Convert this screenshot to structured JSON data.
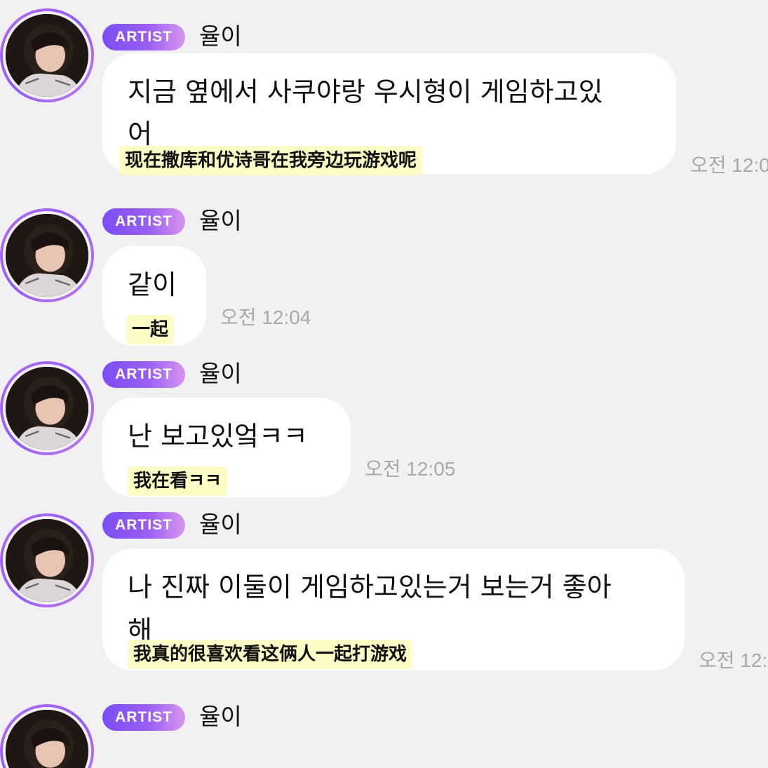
{
  "badge_label": "ARTIST",
  "author_name": "율이",
  "messages": [
    {
      "line1": "지금 옆에서 사쿠야랑 우시형이 게임하고있",
      "line2": "어",
      "translation": "现在撒库和优诗哥在我旁边玩游戏呢",
      "time": "오전 12:0"
    },
    {
      "line1": "같이",
      "translation": "一起",
      "time": "오전 12:04"
    },
    {
      "line1": "난 보고있엌ㅋㅋ",
      "translation": "我在看ㅋㅋ",
      "time": "오전 12:05"
    },
    {
      "line1": "나 진짜 이둘이 게임하고있는거 보는거 좋아",
      "line2": "해",
      "translation": "我真的很喜欢看这俩人一起打游戏",
      "time": "오전 12:"
    }
  ],
  "colors": {
    "background": "#f1f1f3",
    "badge_start": "#7b4ef5",
    "badge_end": "#d795ee",
    "bubble": "#ffffff",
    "translation_highlight": "#fdfcc6",
    "timestamp": "#a9a9ad"
  }
}
